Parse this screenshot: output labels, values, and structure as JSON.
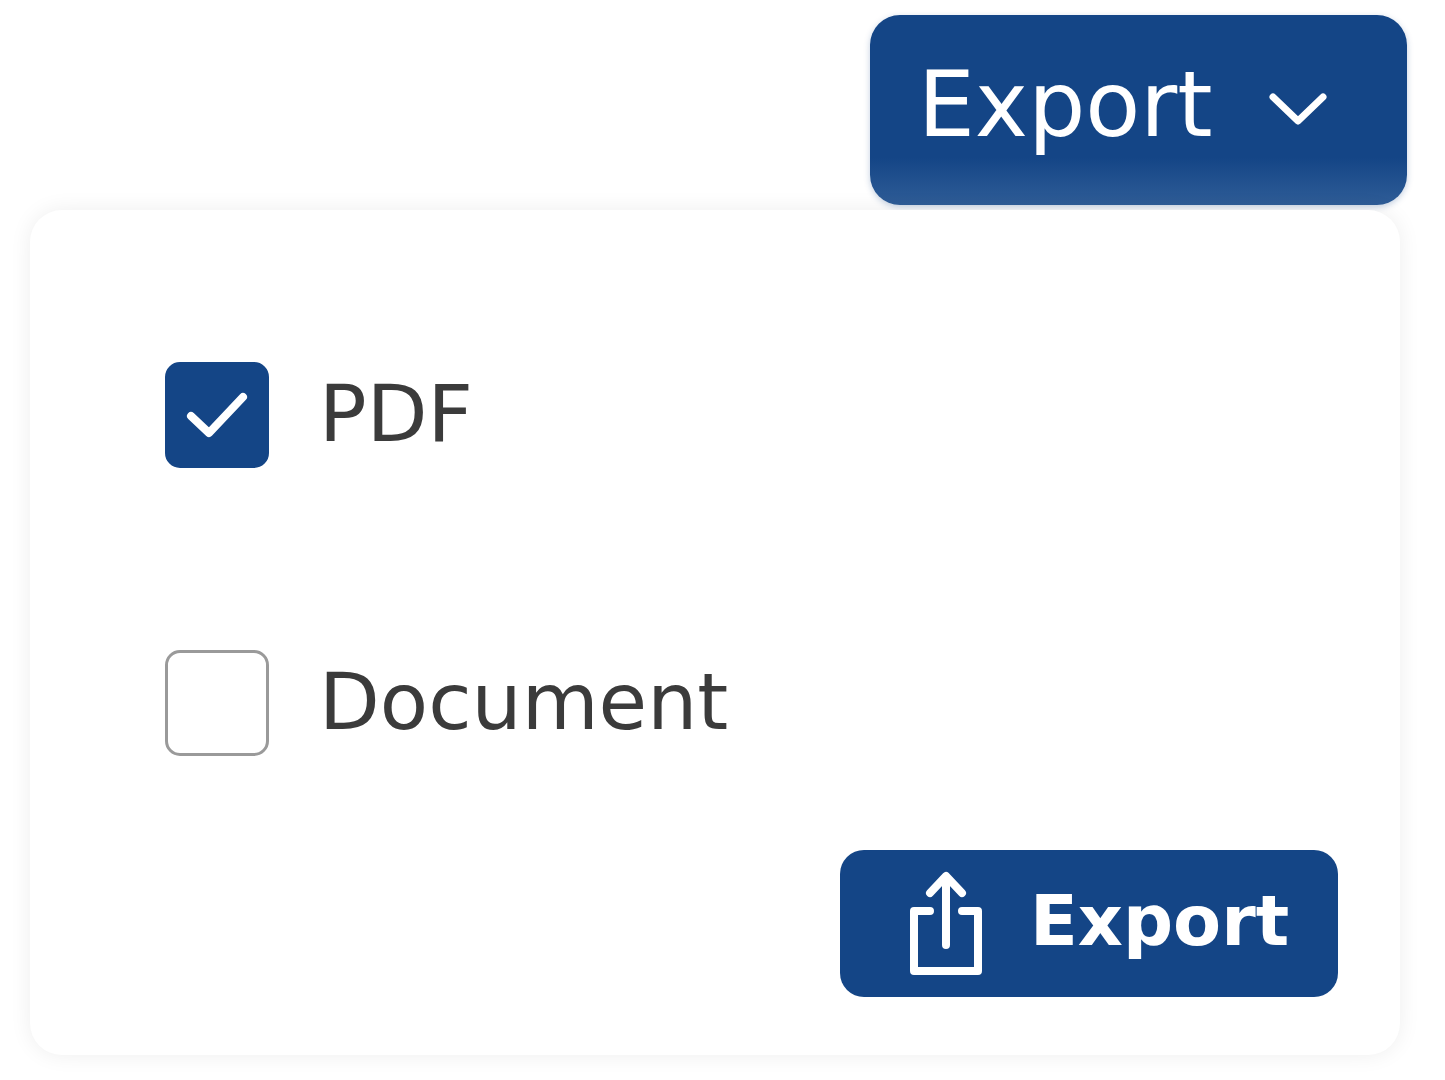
{
  "export_dropdown": {
    "label": "Export",
    "expanded": true
  },
  "export_menu": {
    "options": [
      {
        "label": "PDF",
        "checked": true
      },
      {
        "label": "Document",
        "checked": false
      }
    ],
    "action": {
      "label": "Export"
    }
  }
}
